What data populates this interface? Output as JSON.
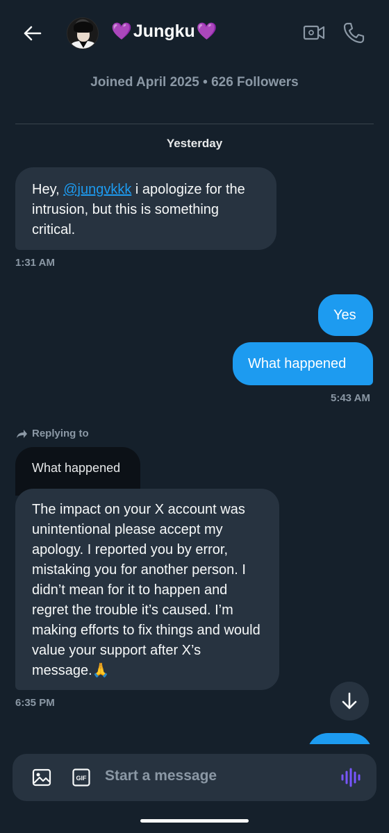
{
  "header": {
    "name_prefix": "💜",
    "name": "Jungku",
    "name_suffix": "💜"
  },
  "profile": {
    "meta": "Joined April 2025 • 626 Followers"
  },
  "date_separator": "Yesterday",
  "messages": [
    {
      "direction": "incoming",
      "text_before": "Hey, ",
      "mention": "@jungvkkk",
      "text_after": " i apologize for the intrusion, but this is something critical.",
      "time": "1:31 AM"
    },
    {
      "direction": "outgoing",
      "text": "Yes"
    },
    {
      "direction": "outgoing",
      "text": "What happened",
      "time": "5:43 AM"
    },
    {
      "direction": "incoming",
      "replying_to_label": "Replying to",
      "quoted_text": "What happened",
      "text": "The impact on your X account was unintentional please accept my apology. I reported you by error, mistaking you for another person. I didn’t mean for it to happen and regret the trouble it’s caused. I’m making efforts to fix things and would value your support after X’s message.🙏",
      "time": "6:35 PM"
    }
  ],
  "composer": {
    "placeholder": "Start a message",
    "gif_label": "GIF"
  },
  "colors": {
    "background": "#15202b",
    "bubble_in": "#273340",
    "bubble_out": "#1d9bf0",
    "muted_text": "#8b98a5",
    "heart": "#b24bf0",
    "voice_icon": "#7856ff"
  },
  "icons": [
    "back-arrow-icon",
    "video-call-icon",
    "phone-icon",
    "reply-arrow-icon",
    "arrow-down-icon",
    "image-icon",
    "gif-icon",
    "voice-wave-icon"
  ]
}
